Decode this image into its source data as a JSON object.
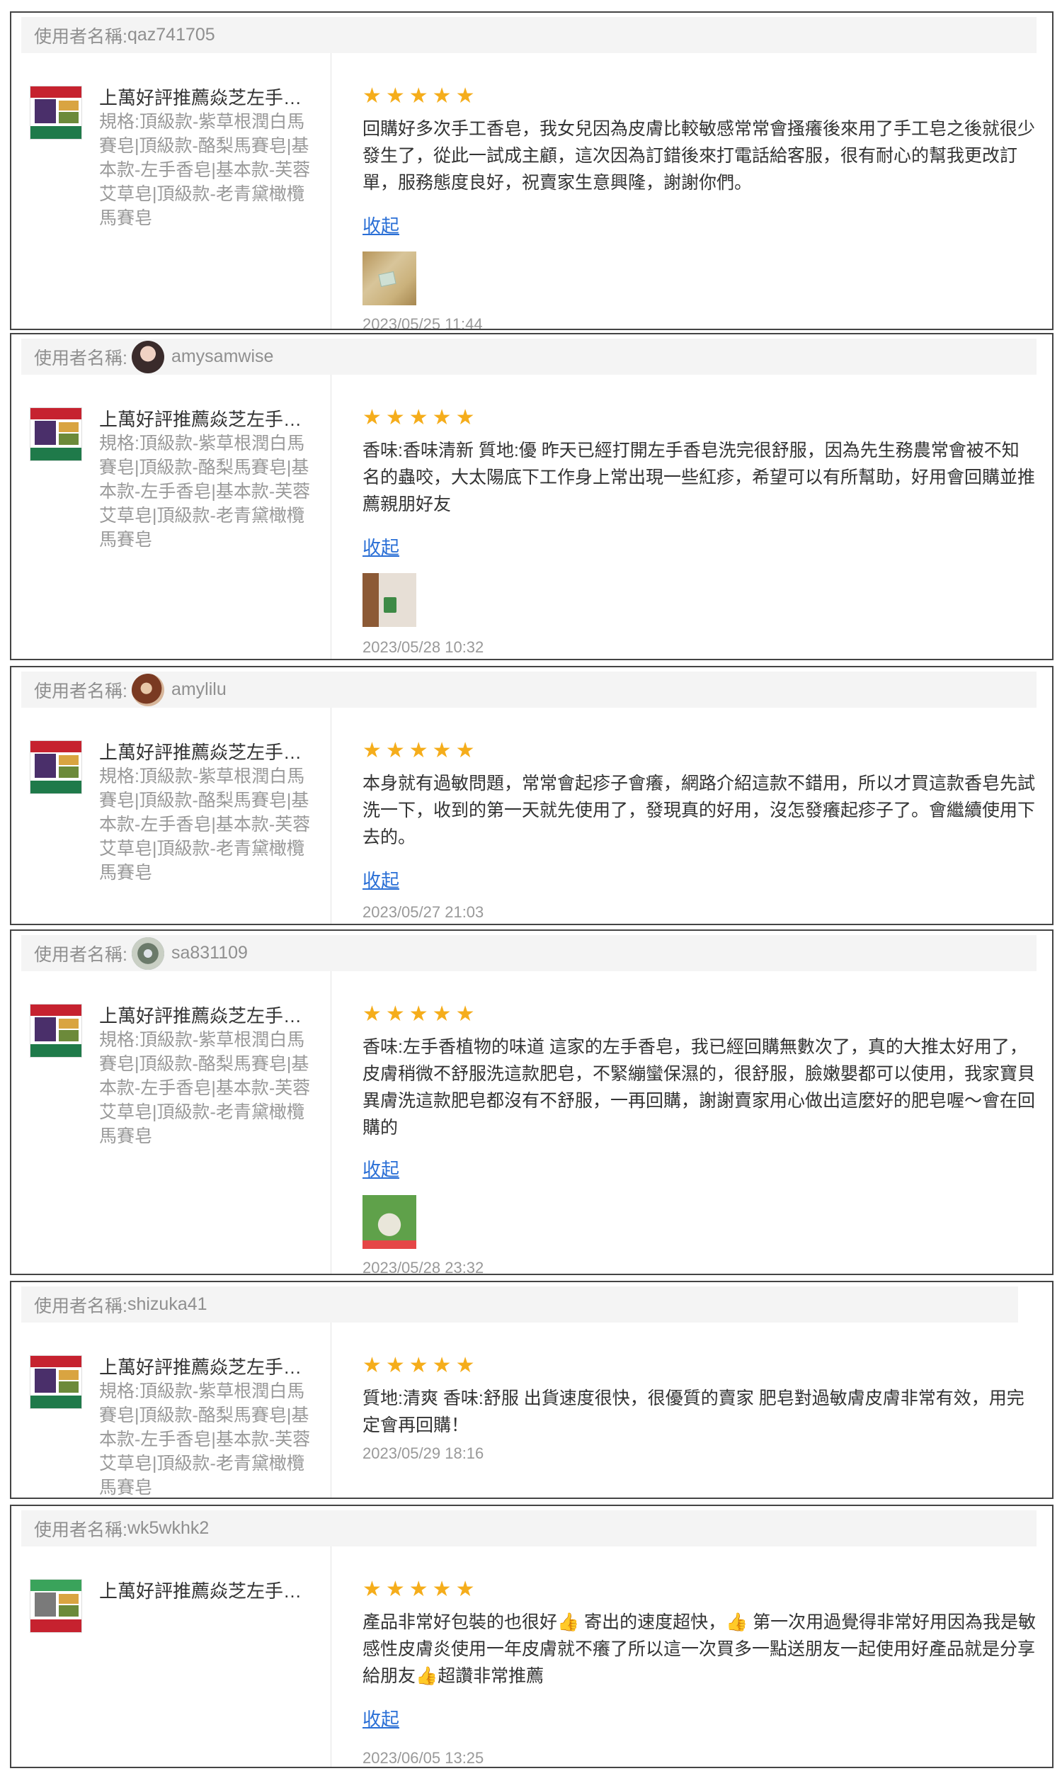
{
  "user_label": "使用者名稱:",
  "product": {
    "title": "上萬好評推薦焱芝左手香皂",
    "spec": "規格:頂級款-紫草根潤白馬賽皂|頂級款-酪梨馬賽皂|基本款-左手香皂|基本款-芙蓉艾草皂|頂級款-老青黛橄欖馬賽皂"
  },
  "collapse_label": "收起",
  "stars": "★★★★★",
  "reviews": [
    {
      "username": "qaz741705",
      "comment": "回購好多次手工香皂，我女兒因為皮膚比較敏感常常會搔癢後來用了手工皂之後就很少發生了，從此一試成主顧，這次因為訂錯後來打電話給客服，很有耐心的幫我更改訂單，服務態度良好，祝賣家生意興隆，謝謝你們。",
      "timestamp": "2023/05/25 11:44"
    },
    {
      "username": "amysamwise",
      "comment": "香味:香味清新 質地:優 昨天已經打開左手香皂洗完很舒服，因為先生務農常會被不知名的蟲咬，大太陽底下工作身上常出現一些紅疹，希望可以有所幫助，好用會回購並推薦親朋好友",
      "timestamp": "2023/05/28 10:32"
    },
    {
      "username": "amylilu",
      "comment": "本身就有過敏問題，常常會起疹子會癢，網路介紹這款不錯用，所以才買這款香皂先試洗一下，收到的第一天就先使用了，發現真的好用，沒怎發癢起疹子了。會繼續使用下去的。",
      "timestamp": "2023/05/27 21:03"
    },
    {
      "username": "sa831109",
      "comment": "香味:左手香植物的味道 這家的左手香皂，我已經回購無數次了，真的大推太好用了，皮膚稍微不舒服洗這款肥皂，不緊繃蠻保濕的，很舒服，臉嫩嬰都可以使用，我家寶貝異膚洗這款肥皂都沒有不舒服，一再回購，謝謝賣家用心做出這麼好的肥皂喔～會在回購的",
      "timestamp": "2023/05/28 23:32"
    },
    {
      "username": "shizuka41",
      "comment": "質地:清爽 香味:舒服 出貨速度很快，很優質的賣家 肥皂對過敏膚皮膚非常有效，用完定會再回購！",
      "timestamp": "2023/05/29 18:16"
    },
    {
      "username": "wk5wkhk2",
      "comment": "產品非常好包裝的也很好👍 寄出的速度超快，👍 第一次用過覺得非常好用因為我是敏感性皮膚炎使用一年皮膚就不癢了所以這一次買多一點送朋友一起使用好產品就是分享給朋友👍超讚非常推薦",
      "timestamp": "2023/06/05 13:25"
    }
  ],
  "icons": {
    "star": "star-icon",
    "avatar": "avatar",
    "product_thumbnail": "product-thumbnail",
    "review_photo": "review-photo"
  },
  "colors": {
    "star": "#f5ad1b",
    "link": "#2a6fd6",
    "header_bg": "#f4f4f4",
    "muted_text": "#999999",
    "border": "#444444"
  }
}
